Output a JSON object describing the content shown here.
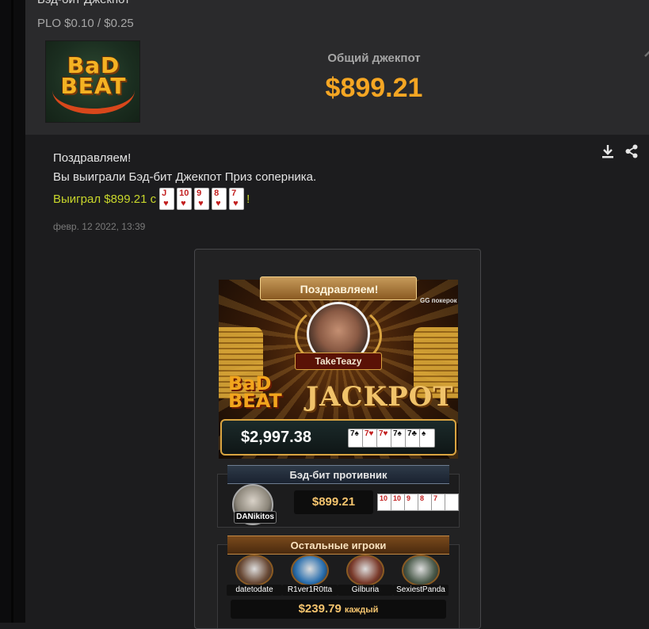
{
  "header": {
    "title_cut": "Бэд-бит Джекпот",
    "stakes": "PLO $0.10 / $0.25",
    "logo_line1": "BaD",
    "logo_line2": "BEAT",
    "jackpot_label": "Общий джекпот",
    "jackpot_amount": "$899.21",
    "collapse_icon": "chevron-up-icon"
  },
  "message": {
    "line1": "Поздравляем!",
    "line2": "Вы выиграли Бэд-бит Джекпот Приз соперника.",
    "won_prefix": "Выиграл $899.21 с ",
    "won_suffix": "!",
    "cards": [
      {
        "rank": "J",
        "suit": "♥"
      },
      {
        "rank": "10",
        "suit": "♥"
      },
      {
        "rank": "9",
        "suit": "♥"
      },
      {
        "rank": "8",
        "suit": "♥"
      },
      {
        "rank": "7",
        "suit": "♥"
      }
    ],
    "date": "февр. 12 2022, 13:39",
    "download_icon": "download-icon",
    "share_icon": "share-icon"
  },
  "banner": {
    "ribbon": "Поздравляем!",
    "brand": "GG покерок",
    "winner": "TakeTeazy",
    "bb_line1": "BaD",
    "bb_line2": "BEAT",
    "jackpot_word": "JACKPOT",
    "prize": "$2,997.38",
    "cards": [
      {
        "rank": "7",
        "suit": "♠",
        "color": "#111111"
      },
      {
        "rank": "7",
        "suit": "♥",
        "color": "#c21e1e"
      },
      {
        "rank": "7",
        "suit": "♥",
        "color": "#c21e1e"
      },
      {
        "rank": "7",
        "suit": "♠",
        "color": "#111111"
      },
      {
        "rank": "7",
        "suit": "♣",
        "color": "#111111"
      },
      {
        "rank": "",
        "suit": "♠",
        "color": "#111111"
      }
    ]
  },
  "opponent": {
    "title": "Бэд-бит противник",
    "name": "DANikitos",
    "amount": "$899.21",
    "cards": [
      "10",
      "10",
      "9",
      "8",
      "7",
      ""
    ]
  },
  "others": {
    "title": "Остальные игроки",
    "players": [
      {
        "name": "datetodate",
        "color": "#6a4a36"
      },
      {
        "name": "R1ver1R0tta",
        "color": "#2a6fae"
      },
      {
        "name": "Gilburia",
        "color": "#7a3a2a"
      },
      {
        "name": "SexiestPanda",
        "color": "#4a5a4a"
      }
    ],
    "each_amount": "$239.79",
    "each_label": "каждый"
  },
  "colors": {
    "accent": "#f5a623",
    "won_text": "#c8d62b",
    "background": "#1c1c1e",
    "header_bg": "#2a2a2c"
  }
}
